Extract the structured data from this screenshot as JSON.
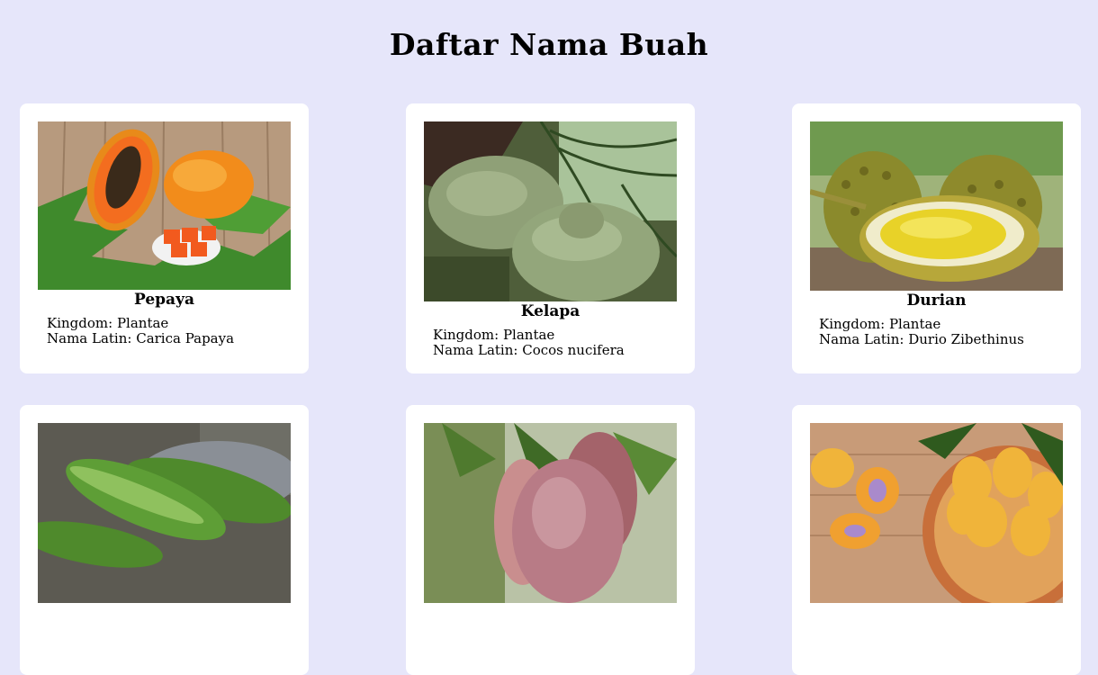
{
  "page": {
    "title": "Daftar Nama Buah"
  },
  "labels": {
    "kingdom_prefix": "Kingdom: ",
    "latin_prefix": "Nama Latin: "
  },
  "fruits": [
    {
      "name": "Pepaya",
      "kingdom": "Plantae",
      "latin": "Carica Papaya",
      "image": "papaya-photo"
    },
    {
      "name": "Kelapa",
      "kingdom": "Plantae",
      "latin": "Cocos nucifera",
      "image": "coconut-photo"
    },
    {
      "name": "Durian",
      "kingdom": "Plantae",
      "latin": "Durio Zibethinus",
      "image": "durian-photo"
    },
    {
      "name": "",
      "kingdom": "",
      "latin": "",
      "image": "cucumber-photo"
    },
    {
      "name": "",
      "kingdom": "",
      "latin": "",
      "image": "mango-photo"
    },
    {
      "name": "",
      "kingdom": "",
      "latin": "",
      "image": "marian-plum-photo"
    }
  ],
  "colors": {
    "background": "#e6e6fa",
    "card": "#ffffff"
  }
}
